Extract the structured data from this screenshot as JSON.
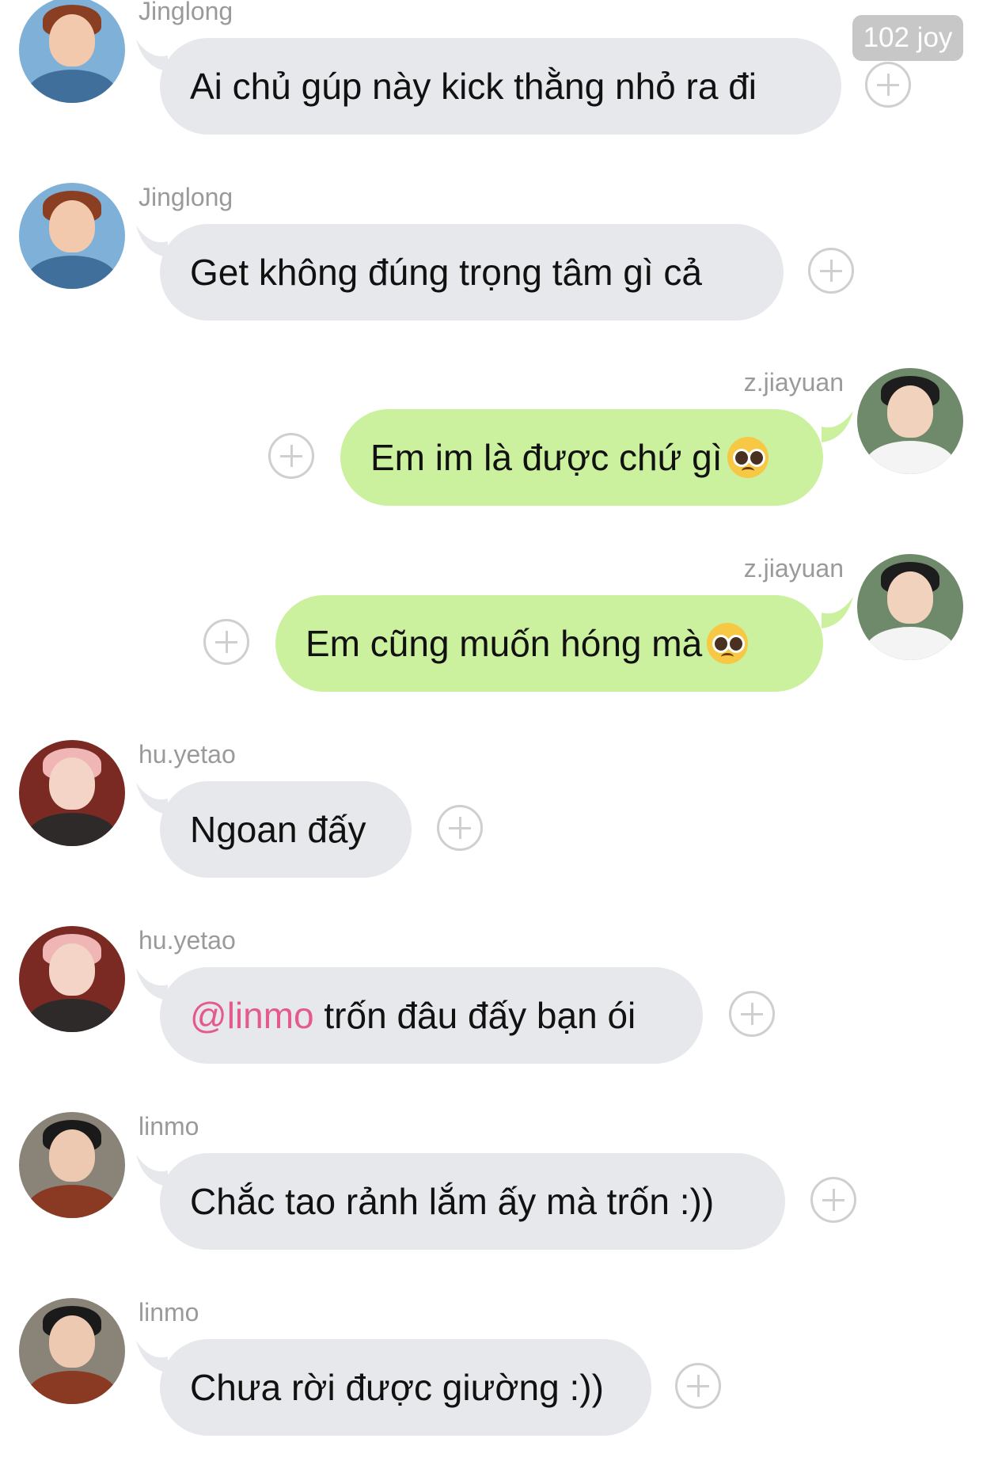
{
  "header": {
    "badge_label": "102 joy"
  },
  "messages": [
    {
      "sender": "Jinglong",
      "text": "Ai chủ gúp này kick thằng nhỏ ra đi",
      "side": "left",
      "avatar": "jinglong-avatar"
    },
    {
      "sender": "Jinglong",
      "text": "Get không đúng trọng tâm gì cả",
      "side": "left",
      "avatar": "jinglong-avatar"
    },
    {
      "sender": "z.jiayuan",
      "text": "Em im là được chứ gì",
      "emoji": "pleading-face-icon",
      "side": "right",
      "avatar": "jiayuan-avatar"
    },
    {
      "sender": "z.jiayuan",
      "text": "Em cũng muốn hóng mà",
      "emoji": "pleading-face-icon",
      "side": "right",
      "avatar": "jiayuan-avatar"
    },
    {
      "sender": "hu.yetao",
      "text": "Ngoan đấy",
      "side": "left",
      "avatar": "yetao-avatar"
    },
    {
      "sender": "hu.yetao",
      "mention": "@linmo",
      "text": " trốn đâu đấy bạn ói",
      "side": "left",
      "avatar": "yetao-avatar"
    },
    {
      "sender": "linmo",
      "text": "Chắc tao rảnh lắm ấy mà trốn :))",
      "side": "left",
      "avatar": "linmo-avatar"
    },
    {
      "sender": "linmo",
      "text": "Chưa rời được giường :))",
      "side": "left",
      "avatar": "linmo-avatar"
    }
  ],
  "colors": {
    "incoming_bubble": "#e7e8ec",
    "outgoing_bubble": "#cbf09e",
    "mention": "#e45a8d",
    "sender_name": "#9a9a9a"
  },
  "icons": {
    "react": "plus-circle-icon"
  }
}
